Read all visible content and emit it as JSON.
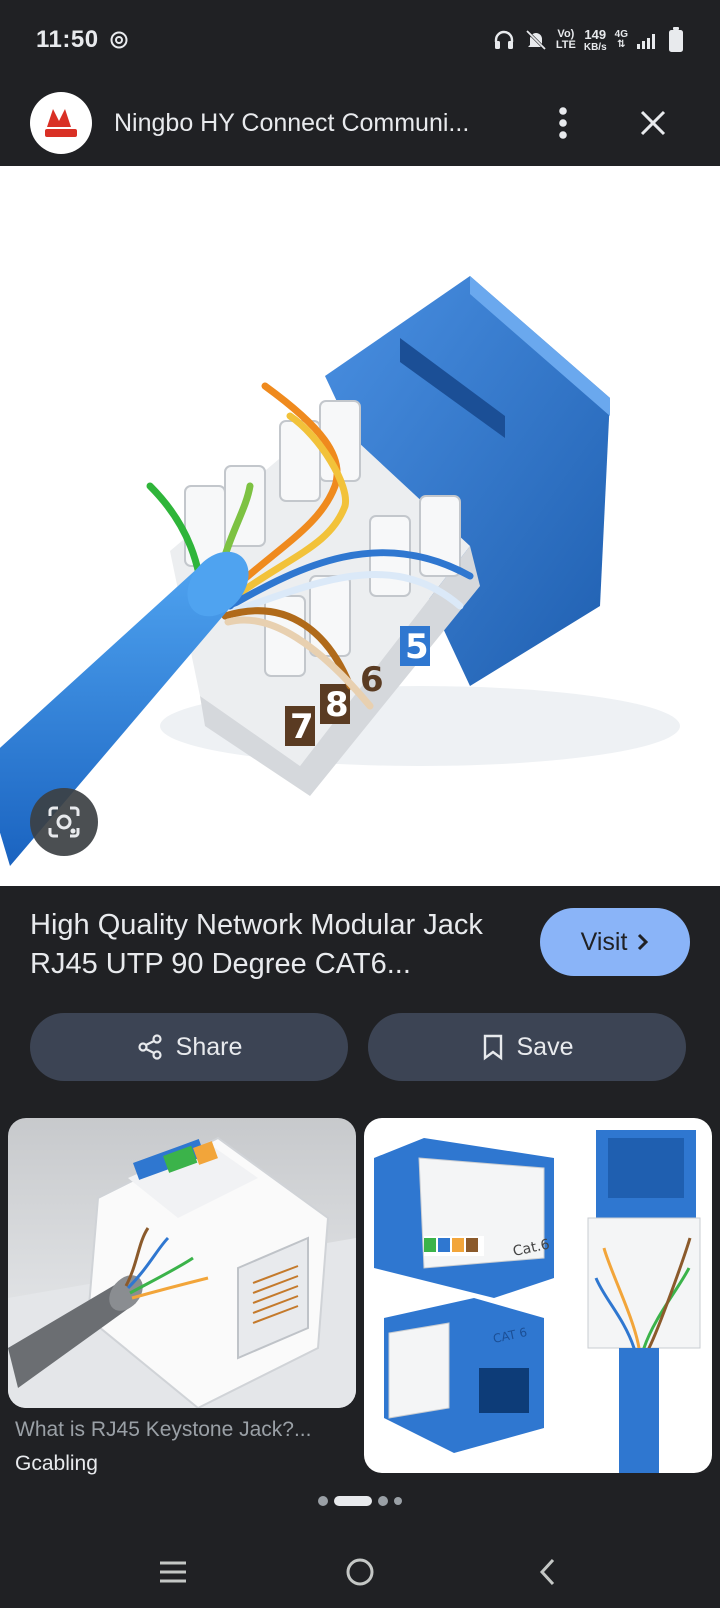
{
  "status_bar": {
    "time": "11:50",
    "volte_top": "Vo)",
    "volte_bottom": "LTE",
    "speed_value": "149",
    "speed_unit": "KB/s",
    "network": "4G",
    "icons": [
      "threads-icon",
      "headphones-icon",
      "mute-icon",
      "signal-icon",
      "battery-icon"
    ]
  },
  "header": {
    "site_logo": "site-logo",
    "title": "Ningbo HY Connect Communi..."
  },
  "product": {
    "title": "High Quality Network Modular Jack RJ45 UTP 90 Degree CAT6...",
    "visit_label": "Visit",
    "share_label": "Share",
    "save_label": "Save"
  },
  "hero_image": {
    "jack_numbers": [
      "7",
      "8",
      "6",
      "5"
    ]
  },
  "related": [
    {
      "caption": "What is RJ45 Keystone Jack?...",
      "source": "Gcabling"
    },
    {
      "labels": [
        "Cat.6",
        "CAT 6"
      ]
    }
  ],
  "colors": {
    "background": "#202124",
    "accent": "#8ab4f8",
    "pill": "#3c4454",
    "jack_blue": "#2f77d0"
  }
}
